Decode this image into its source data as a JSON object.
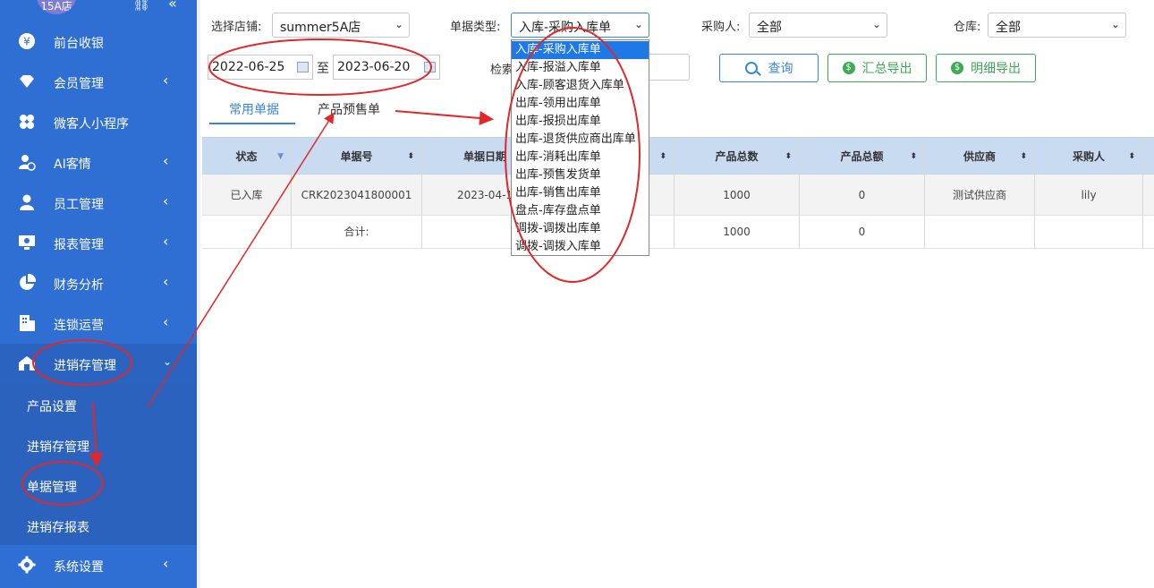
{
  "sidebar": {
    "store_badge": "15A店",
    "items": [
      {
        "label": "前台收银",
        "icon": "yen-icon"
      },
      {
        "label": "会员管理",
        "icon": "diamond-icon"
      },
      {
        "label": "微客人小程序",
        "icon": "clover-icon"
      },
      {
        "label": "AI客情",
        "icon": "person-check-icon"
      },
      {
        "label": "员工管理",
        "icon": "user-icon"
      },
      {
        "label": "报表管理",
        "icon": "monitor-icon"
      },
      {
        "label": "财务分析",
        "icon": "pie-icon"
      },
      {
        "label": "连锁运营",
        "icon": "building-icon"
      },
      {
        "label": "进销存管理",
        "icon": "warehouse-icon"
      },
      {
        "label": "系统设置",
        "icon": "gear-icon"
      }
    ],
    "submenu": [
      "产品设置",
      "进销存管理",
      "单据管理",
      "进销存报表"
    ]
  },
  "filters": {
    "store_label": "选择店铺:",
    "store_value": "summer5A店",
    "doc_type_label": "单据类型:",
    "doc_type_value": "入库-采购入库单",
    "purchaser_label": "采购人:",
    "purchaser_value": "全部",
    "warehouse_label": "仓库:",
    "warehouse_value": "全部",
    "date_from": "2022-06-25",
    "date_to_sep": "至",
    "date_to": "2023-06-20",
    "search_label": "检索"
  },
  "buttons": {
    "query": "查询",
    "summary_export": "汇总导出",
    "detail_export": "明细导出"
  },
  "tabs": [
    "常用单据",
    "产品预售单"
  ],
  "table": {
    "headers": [
      "状态",
      "单据号",
      "单据日期",
      "",
      "产品总数",
      "产品总额",
      "供应商",
      "采购人"
    ],
    "rows": [
      [
        "已入库",
        "CRK2023041800001",
        "2023-04-1",
        "",
        "1000",
        "0",
        "测试供应商",
        "lily"
      ]
    ],
    "total_label": "合计:",
    "total_qty": "1000",
    "total_amount": "0"
  },
  "dropdown_options": [
    "入库-采购入库单",
    "入库-报溢入库单",
    "入库-顾客退货入库单",
    "出库-领用出库单",
    "出库-报损出库单",
    "出库-退货供应商出库单",
    "出库-消耗出库单",
    "出库-预售发货单",
    "出库-销售出库单",
    "盘点-库存盘点单",
    "调拨-调拨出库单",
    "调拨-调拨入库单"
  ],
  "colors": {
    "sidebar": "#2f6fd4",
    "accent": "#3a86d8",
    "export_green": "#3daa55",
    "annotation_red": "#e0282a"
  }
}
